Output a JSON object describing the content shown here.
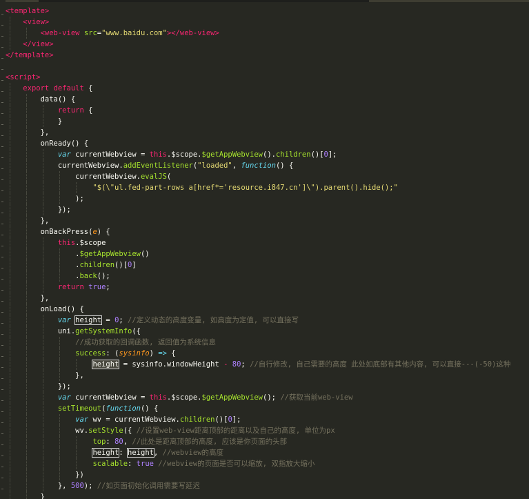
{
  "editor": {
    "lines": [
      [
        [
          "t-tag",
          "<template"
        ],
        [
          "t-tag",
          ">"
        ]
      ],
      [
        [
          "t-plain",
          "    "
        ],
        [
          "t-tag",
          "<view"
        ],
        [
          "t-tag",
          ">"
        ]
      ],
      [
        [
          "t-plain",
          "        "
        ],
        [
          "t-tag",
          "<web-view"
        ],
        [
          "t-plain",
          " "
        ],
        [
          "t-attr",
          "src"
        ],
        [
          "t-plain",
          "="
        ],
        [
          "t-str",
          "\"www.baidu.com\""
        ],
        [
          "t-tag",
          ">"
        ],
        [
          "t-tag",
          "</web-view"
        ],
        [
          "t-tag",
          ">"
        ]
      ],
      [
        [
          "t-plain",
          "    "
        ],
        [
          "t-tag",
          "</view"
        ],
        [
          "t-tag",
          ">"
        ]
      ],
      [
        [
          "t-tag",
          "</template"
        ],
        [
          "t-tag",
          ">"
        ]
      ],
      [],
      [
        [
          "t-tag",
          "<script"
        ],
        [
          "t-tag",
          ">"
        ]
      ],
      [
        [
          "t-plain",
          "    "
        ],
        [
          "t-kw",
          "export"
        ],
        [
          "t-plain",
          " "
        ],
        [
          "t-kw",
          "default"
        ],
        [
          "t-plain",
          " {"
        ]
      ],
      [
        [
          "t-plain",
          "        data() {"
        ]
      ],
      [
        [
          "t-plain",
          "            "
        ],
        [
          "t-kw",
          "return"
        ],
        [
          "t-plain",
          " {"
        ]
      ],
      [
        [
          "t-plain",
          "            }"
        ]
      ],
      [
        [
          "t-plain",
          "        },"
        ]
      ],
      [
        [
          "t-plain",
          "        onReady() {"
        ]
      ],
      [
        [
          "t-plain",
          "            "
        ],
        [
          "t-storage",
          "var"
        ],
        [
          "t-plain",
          " currentWebview = "
        ],
        [
          "t-kw",
          "this"
        ],
        [
          "t-plain",
          ".$scope."
        ],
        [
          "t-fn",
          "$getAppWebview"
        ],
        [
          "t-plain",
          "()."
        ],
        [
          "t-fn",
          "children"
        ],
        [
          "t-plain",
          "()["
        ],
        [
          "t-num",
          "0"
        ],
        [
          "t-plain",
          "];"
        ]
      ],
      [
        [
          "t-plain",
          "            currentWebview."
        ],
        [
          "t-fn",
          "addEventListener"
        ],
        [
          "t-plain",
          "("
        ],
        [
          "t-str",
          "\"loaded\""
        ],
        [
          "t-plain",
          ", "
        ],
        [
          "t-storage",
          "function"
        ],
        [
          "t-plain",
          "() {"
        ]
      ],
      [
        [
          "t-plain",
          "                currentWebview."
        ],
        [
          "t-fn",
          "evalJS"
        ],
        [
          "t-plain",
          "("
        ]
      ],
      [
        [
          "t-plain",
          "                    "
        ],
        [
          "t-str",
          "\"$(\\\"ul.fed-part-rows a[href*='resource.i847.cn']\\\").parent().hide();\""
        ]
      ],
      [
        [
          "t-plain",
          "                );"
        ]
      ],
      [
        [
          "t-plain",
          "            });"
        ]
      ],
      [
        [
          "t-plain",
          "        },"
        ]
      ],
      [
        [
          "t-plain",
          "        onBackPress("
        ],
        [
          "t-param",
          "e"
        ],
        [
          "t-plain",
          ") {"
        ]
      ],
      [
        [
          "t-plain",
          "            "
        ],
        [
          "t-kw",
          "this"
        ],
        [
          "t-plain",
          ".$scope"
        ]
      ],
      [
        [
          "t-plain",
          "                ."
        ],
        [
          "t-fn",
          "$getAppWebview"
        ],
        [
          "t-plain",
          "()"
        ]
      ],
      [
        [
          "t-plain",
          "                ."
        ],
        [
          "t-fn",
          "children"
        ],
        [
          "t-plain",
          "()["
        ],
        [
          "t-num",
          "0"
        ],
        [
          "t-plain",
          "]"
        ]
      ],
      [
        [
          "t-plain",
          "                ."
        ],
        [
          "t-fn",
          "back"
        ],
        [
          "t-plain",
          "();"
        ]
      ],
      [
        [
          "t-plain",
          "            "
        ],
        [
          "t-kw",
          "return"
        ],
        [
          "t-plain",
          " "
        ],
        [
          "t-bool",
          "true"
        ],
        [
          "t-plain",
          ";"
        ]
      ],
      [
        [
          "t-plain",
          "        },"
        ]
      ],
      [
        [
          "t-plain",
          "        onLoad() {"
        ]
      ],
      [
        [
          "t-plain",
          "            "
        ],
        [
          "t-storage",
          "var"
        ],
        [
          "t-plain",
          " "
        ],
        [
          "hl",
          "height"
        ],
        [
          "t-plain",
          " = "
        ],
        [
          "t-num",
          "0"
        ],
        [
          "t-plain",
          "; "
        ],
        [
          "t-comment",
          "//定义动态的高度变量, 如高度为定值, 可以直接写"
        ]
      ],
      [
        [
          "t-plain",
          "            uni."
        ],
        [
          "t-fn",
          "getSystemInfo"
        ],
        [
          "t-plain",
          "({"
        ]
      ],
      [
        [
          "t-plain",
          "                "
        ],
        [
          "t-comment",
          "//成功获取的回调函数, 返回值为系统信息"
        ]
      ],
      [
        [
          "t-plain",
          "                "
        ],
        [
          "t-fn",
          "success"
        ],
        [
          "t-plain",
          ": ("
        ],
        [
          "t-param",
          "sysinfo"
        ],
        [
          "t-plain",
          ") "
        ],
        [
          "t-storage",
          "=>"
        ],
        [
          "t-plain",
          " {"
        ]
      ],
      [
        [
          "t-plain",
          "                    "
        ],
        [
          "hl-sel",
          "height"
        ],
        [
          "t-plain",
          " = sysinfo.windowHeight "
        ],
        [
          "t-kw",
          "-"
        ],
        [
          "t-plain",
          " "
        ],
        [
          "t-num",
          "80"
        ],
        [
          "t-plain",
          "; "
        ],
        [
          "t-comment",
          "//自行修改, 自己需要的高度 此处如底部有其他内容, 可以直接---(-50)这种"
        ]
      ],
      [
        [
          "t-plain",
          "                },"
        ]
      ],
      [
        [
          "t-plain",
          "            });"
        ]
      ],
      [
        [
          "t-plain",
          "            "
        ],
        [
          "t-storage",
          "var"
        ],
        [
          "t-plain",
          " currentWebview = "
        ],
        [
          "t-kw",
          "this"
        ],
        [
          "t-plain",
          ".$scope."
        ],
        [
          "t-fn",
          "$getAppWebview"
        ],
        [
          "t-plain",
          "(); "
        ],
        [
          "t-comment",
          "//获取当前web-view"
        ]
      ],
      [
        [
          "t-plain",
          "            "
        ],
        [
          "t-fn",
          "setTimeout"
        ],
        [
          "t-plain",
          "("
        ],
        [
          "t-storage",
          "function"
        ],
        [
          "t-plain",
          "() {"
        ]
      ],
      [
        [
          "t-plain",
          "                "
        ],
        [
          "t-storage",
          "var"
        ],
        [
          "t-plain",
          " wv = currentWebview."
        ],
        [
          "t-fn",
          "children"
        ],
        [
          "t-plain",
          "()["
        ],
        [
          "t-num",
          "0"
        ],
        [
          "t-plain",
          "];"
        ]
      ],
      [
        [
          "t-plain",
          "                wv."
        ],
        [
          "t-fn",
          "setStyle"
        ],
        [
          "t-plain",
          "({ "
        ],
        [
          "t-comment",
          "//设置web-view距离顶部的距离以及自己的高度, 单位为px"
        ]
      ],
      [
        [
          "t-plain",
          "                    "
        ],
        [
          "t-fn",
          "top"
        ],
        [
          "t-plain",
          ": "
        ],
        [
          "t-num",
          "80"
        ],
        [
          "t-plain",
          ", "
        ],
        [
          "t-comment",
          "//此处是距离顶部的高度, 应该是你页面的头部"
        ]
      ],
      [
        [
          "t-plain",
          "                    "
        ],
        [
          "hl",
          "height"
        ],
        [
          "t-plain",
          ": "
        ],
        [
          "hl",
          "height"
        ],
        [
          "t-plain",
          ", "
        ],
        [
          "t-comment",
          "//webview的高度"
        ]
      ],
      [
        [
          "t-plain",
          "                    "
        ],
        [
          "t-fn",
          "scalable"
        ],
        [
          "t-plain",
          ": "
        ],
        [
          "t-bool",
          "true"
        ],
        [
          "t-plain",
          " "
        ],
        [
          "t-comment",
          "//webview的页面是否可以缩放, 双指放大缩小"
        ]
      ],
      [
        [
          "t-plain",
          "                })"
        ]
      ],
      [
        [
          "t-plain",
          "            }, "
        ],
        [
          "t-num",
          "500"
        ],
        [
          "t-plain",
          "); "
        ],
        [
          "t-comment",
          "//如页面初始化调用需要写延迟"
        ]
      ],
      [
        [
          "t-plain",
          "        }"
        ]
      ]
    ]
  }
}
